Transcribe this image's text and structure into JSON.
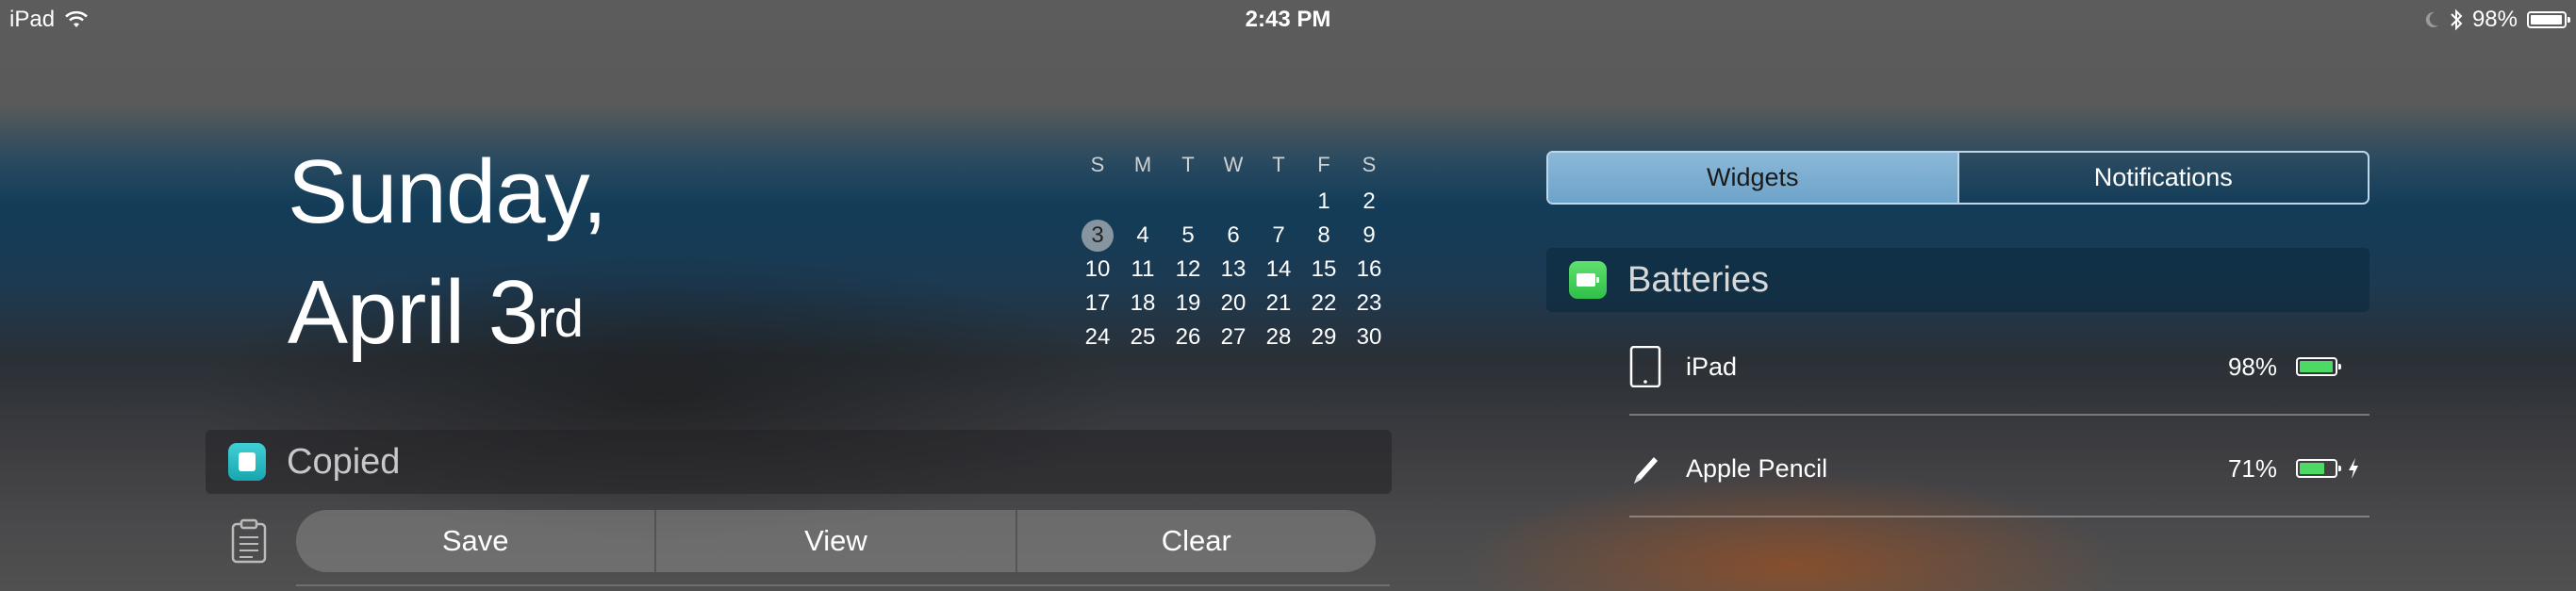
{
  "status_bar": {
    "device": "iPad",
    "time": "2:43 PM",
    "battery_percent": "98%",
    "battery_level": 0.98,
    "icons": [
      "wifi-icon",
      "moon-icon",
      "bluetooth-icon",
      "battery-icon"
    ]
  },
  "date": {
    "weekday": "Sunday,",
    "month_day": "April 3",
    "suffix": "rd"
  },
  "calendar": {
    "weekdays": [
      "S",
      "M",
      "T",
      "W",
      "T",
      "F",
      "S"
    ],
    "weeks": [
      [
        "",
        "",
        "",
        "",
        "",
        "1",
        "2"
      ],
      [
        "3",
        "4",
        "5",
        "6",
        "7",
        "8",
        "9"
      ],
      [
        "10",
        "11",
        "12",
        "13",
        "14",
        "15",
        "16"
      ],
      [
        "17",
        "18",
        "19",
        "20",
        "21",
        "22",
        "23"
      ],
      [
        "24",
        "25",
        "26",
        "27",
        "28",
        "29",
        "30"
      ]
    ],
    "today": "3"
  },
  "copied_widget": {
    "title": "Copied",
    "actions": [
      "Save",
      "View",
      "Clear"
    ]
  },
  "segmented": {
    "tabs": [
      "Widgets",
      "Notifications"
    ],
    "selected": "Widgets"
  },
  "batteries_widget": {
    "title": "Batteries",
    "devices": [
      {
        "name": "iPad",
        "percent": "98%",
        "level": 0.98,
        "charging": false,
        "icon": "ipad-icon"
      },
      {
        "name": "Apple Pencil",
        "percent": "71%",
        "level": 0.71,
        "charging": true,
        "icon": "pencil-icon"
      }
    ]
  },
  "colors": {
    "segment_accent": "#7fb0d4",
    "battery_green": "#4cd964",
    "copied_accent": "#2bbdc4"
  }
}
